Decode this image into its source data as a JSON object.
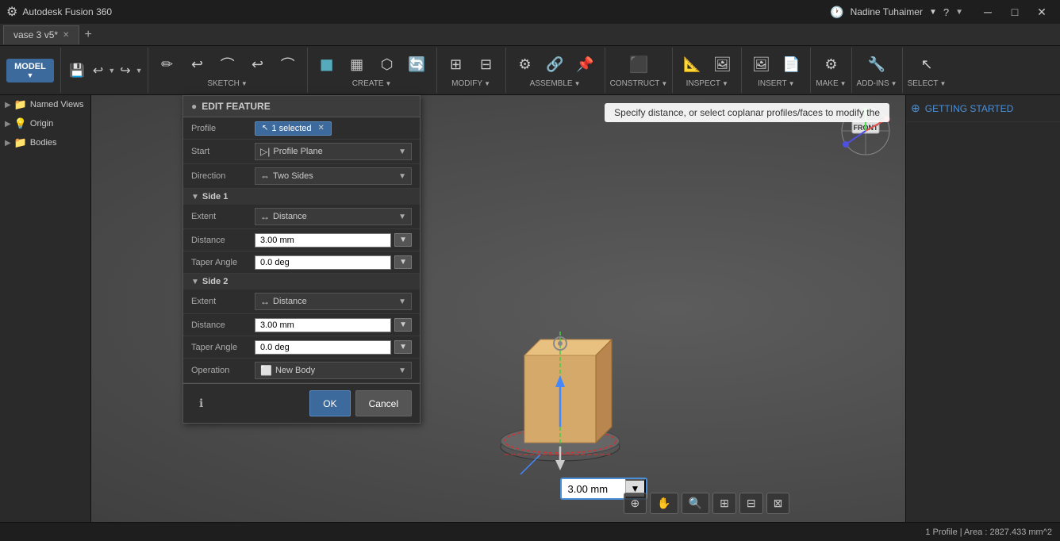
{
  "app": {
    "name": "Autodesk Fusion 360",
    "icon": "⚙"
  },
  "titlebar": {
    "title": "Autodesk Fusion 360",
    "tab_name": "vase 3 v5*",
    "minimize": "─",
    "restore": "□",
    "close": "✕",
    "user": "Nadine Tuhaimer",
    "help": "?"
  },
  "toolbar": {
    "save_icon": "💾",
    "undo_icon": "↩",
    "redo_icon": "↪",
    "model_label": "MODEL",
    "sections": [
      {
        "label": "SKETCH",
        "has_caret": true
      },
      {
        "label": "CREATE",
        "has_caret": true
      },
      {
        "label": "MODIFY",
        "has_caret": true
      },
      {
        "label": "ASSEMBLE",
        "has_caret": true
      },
      {
        "label": "CONSTRUCT",
        "has_caret": true
      },
      {
        "label": "INSPECT",
        "has_caret": true
      },
      {
        "label": "INSERT",
        "has_caret": true
      },
      {
        "label": "MAKE",
        "has_caret": true
      },
      {
        "label": "ADD-INS",
        "has_caret": true
      },
      {
        "label": "SELECT",
        "has_caret": true
      }
    ]
  },
  "sidebar": {
    "named_views": "Named Views",
    "origin": "Origin",
    "bodies": "Bodies"
  },
  "edit_feature": {
    "title": "EDIT FEATURE",
    "profile_label": "Profile",
    "profile_value": "1 selected",
    "start_label": "Start",
    "start_value": "Profile Plane",
    "direction_label": "Direction",
    "direction_value": "Two Sides",
    "side1_label": "Side 1",
    "side1_extent_label": "Extent",
    "side1_extent_value": "Distance",
    "side1_distance_label": "Distance",
    "side1_distance_value": "3.00 mm",
    "side1_taper_label": "Taper Angle",
    "side1_taper_value": "0.0 deg",
    "side2_label": "Side 2",
    "side2_extent_label": "Extent",
    "side2_extent_value": "Distance",
    "side2_distance_label": "Distance",
    "side2_distance_value": "3.00 mm",
    "side2_taper_label": "Taper Angle",
    "side2_taper_value": "0.0 deg",
    "operation_label": "Operation",
    "operation_value": "New Body",
    "ok_label": "OK",
    "cancel_label": "Cancel"
  },
  "viewport": {
    "hint": "Specify distance, or select coplanar profiles/faces to modify the",
    "measurement_value": "3.00 mm",
    "gizmo_front": "FRONT",
    "getting_started": "GETTING STARTED"
  },
  "statusbar": {
    "profile_info": "1 Profile | Area : 2827.433 mm^2"
  }
}
